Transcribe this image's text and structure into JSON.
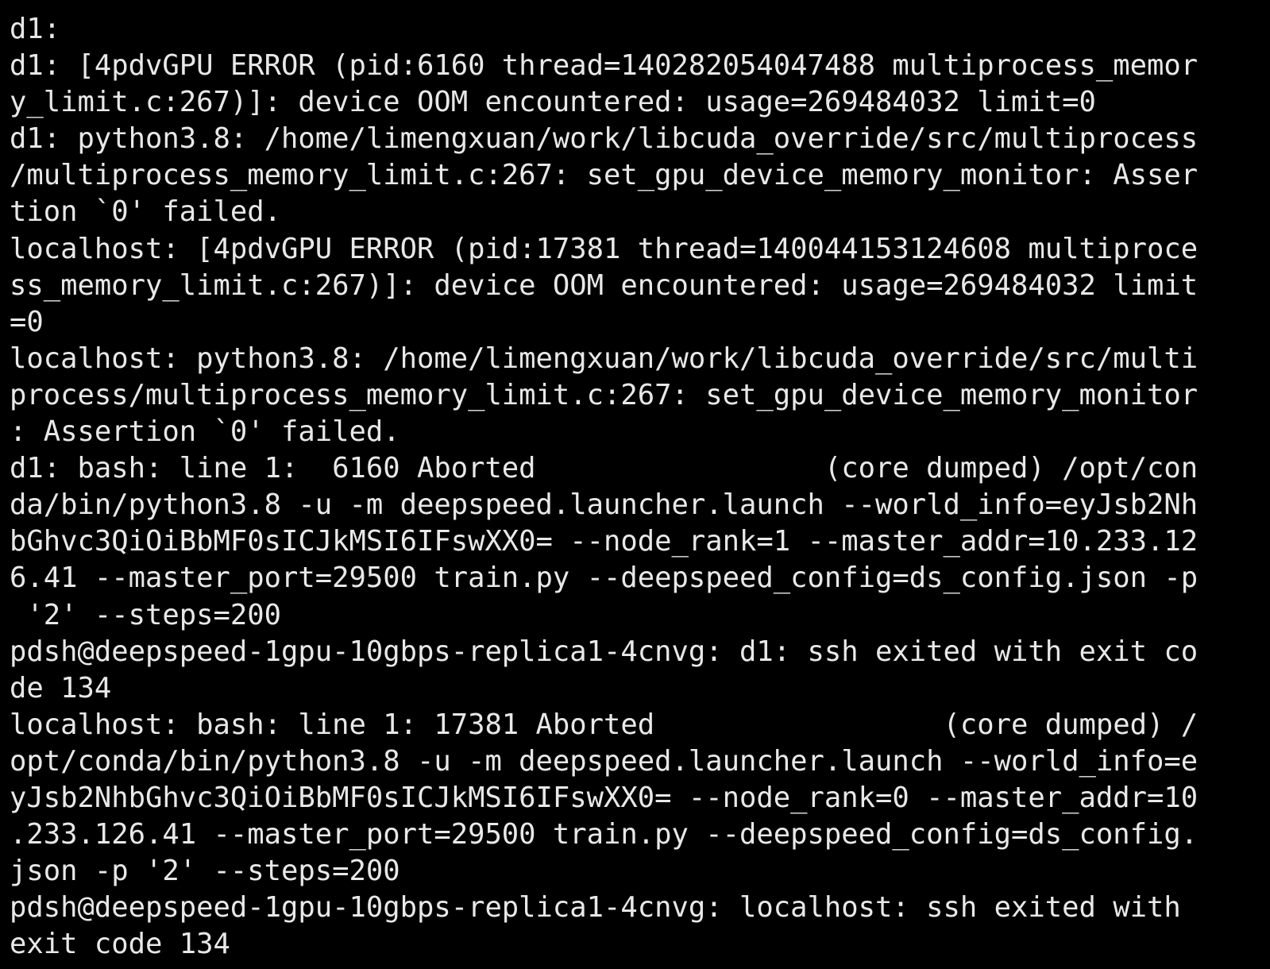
{
  "terminal": {
    "colors": {
      "background": "#000000",
      "foreground": "#e8e8e8"
    },
    "lines": [
      "d1:",
      "d1: [4pdvGPU ERROR (pid:6160 thread=140282054047488 multiprocess_memor",
      "y_limit.c:267)]: device OOM encountered: usage=269484032 limit=0",
      "d1: python3.8: /home/limengxuan/work/libcuda_override/src/multiprocess",
      "/multiprocess_memory_limit.c:267: set_gpu_device_memory_monitor: Asser",
      "tion `0' failed.",
      "localhost: [4pdvGPU ERROR (pid:17381 thread=140044153124608 multiproce",
      "ss_memory_limit.c:267)]: device OOM encountered: usage=269484032 limit",
      "=0",
      "localhost: python3.8: /home/limengxuan/work/libcuda_override/src/multi",
      "process/multiprocess_memory_limit.c:267: set_gpu_device_memory_monitor",
      ": Assertion `0' failed.",
      "d1: bash: line 1:  6160 Aborted                 (core dumped) /opt/con",
      "da/bin/python3.8 -u -m deepspeed.launcher.launch --world_info=eyJsb2Nh",
      "bGhvc3QiOiBbMF0sICJkMSI6IFswXX0= --node_rank=1 --master_addr=10.233.12",
      "6.41 --master_port=29500 train.py --deepspeed_config=ds_config.json -p",
      " '2' --steps=200",
      "pdsh@deepspeed-1gpu-10gbps-replica1-4cnvg: d1: ssh exited with exit co",
      "de 134",
      "localhost: bash: line 1: 17381 Aborted                 (core dumped) /",
      "opt/conda/bin/python3.8 -u -m deepspeed.launcher.launch --world_info=e",
      "yJsb2NhbGhvc3QiOiBbMF0sICJkMSI6IFswXX0= --node_rank=0 --master_addr=10",
      ".233.126.41 --master_port=29500 train.py --deepspeed_config=ds_config.",
      "json -p '2' --steps=200",
      "pdsh@deepspeed-1gpu-10gbps-replica1-4cnvg: localhost: ssh exited with",
      "exit code 134"
    ]
  }
}
